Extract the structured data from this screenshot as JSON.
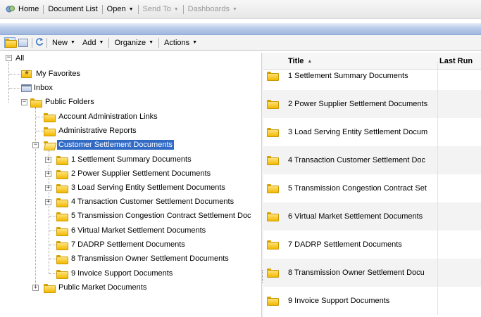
{
  "menubar": {
    "home": "Home",
    "document_list": "Document List",
    "open": "Open",
    "send_to": "Send To",
    "dashboards": "Dashboards"
  },
  "toolbar": {
    "new": "New",
    "add": "Add",
    "organize": "Organize",
    "actions": "Actions"
  },
  "tree": {
    "root": "All",
    "my_favorites": "My Favorites",
    "inbox": "Inbox",
    "public_folders": "Public Folders",
    "account_admin": "Account Administration Links",
    "admin_reports": "Administrative Reports",
    "customer_settlement": "Customer Settlement Documents",
    "children": [
      "1 Settlement Summary Documents",
      "2 Power Supplier Settlement Documents",
      "3 Load Serving Entity Settlement Documents",
      "4 Transaction Customer Settlement Documents",
      "5 Transmission Congestion Contract Settlement Doc",
      "6 Virtual Market Settlement Documents",
      "7 DADRP Settlement Documents",
      "8 Transmission Owner Settlement Documents",
      "9 Invoice Support Documents"
    ],
    "public_market": "Public Market Documents"
  },
  "list": {
    "col_title": "Title",
    "col_last_run": "Last Run",
    "rows": [
      "1 Settlement Summary Documents",
      "2 Power Supplier Settlement Documents",
      "3 Load Serving Entity Settlement Docum",
      "4 Transaction Customer Settlement Doc",
      "5 Transmission Congestion Contract Set",
      "6 Virtual Market Settlement Documents",
      "7 DADRP Settlement Documents",
      "8 Transmission Owner Settlement Docu",
      "9 Invoice Support Documents"
    ]
  },
  "colors": {
    "selection": "#316ac5",
    "folder": "#f2b900",
    "header_blue": "#b8cbe9"
  }
}
